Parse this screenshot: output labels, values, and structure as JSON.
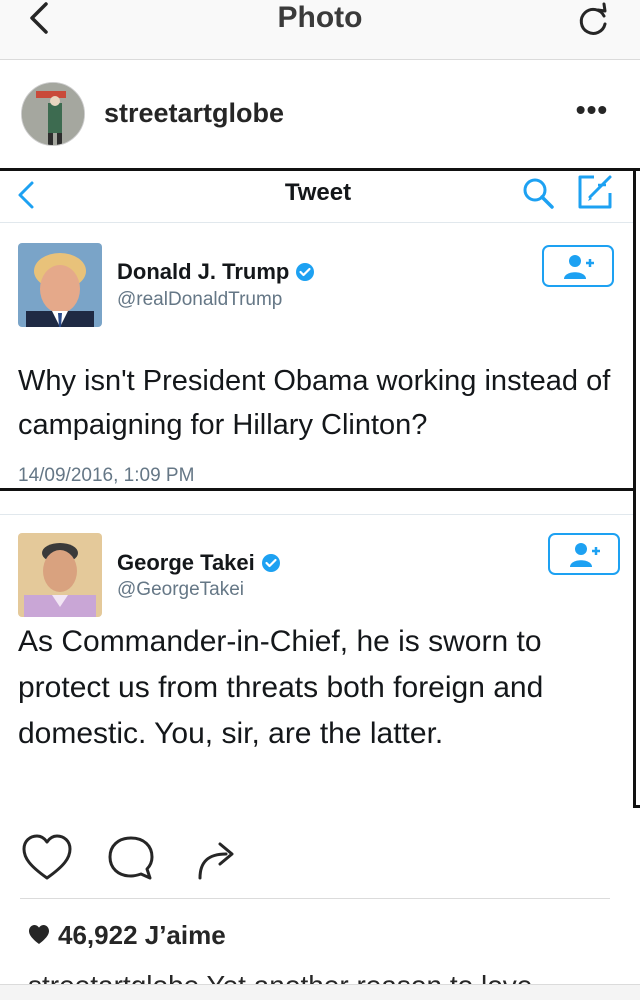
{
  "header": {
    "title": "Photo",
    "back_icon": "chevron-left-icon",
    "refresh_icon": "refresh-icon"
  },
  "post": {
    "author": "streetartglobe",
    "more_icon": "more-dots-icon",
    "more_label": "•••"
  },
  "tweet_view": {
    "title": "Tweet",
    "back_icon": "chevron-left-icon",
    "search_icon": "search-icon",
    "compose_icon": "compose-icon",
    "accent": "#1da1f2"
  },
  "tweets": [
    {
      "name": "Donald J. Trump",
      "handle": "@realDonaldTrump",
      "text": "Why isn't President Obama working instead of campaigning for Hillary Clinton?",
      "timestamp": "14/09/2016, 1:09 PM",
      "verified": true
    },
    {
      "name": "George Takei",
      "handle": "@GeorgeTakei",
      "text": "As Commander-in-Chief, he is sworn to protect us from threats both foreign and domestic. You, sir, are the latter.",
      "verified": true
    }
  ],
  "actions": {
    "like_icon": "heart-icon",
    "comment_icon": "comment-icon",
    "share_icon": "share-icon"
  },
  "likes": {
    "text": "46,922 J’aime"
  },
  "caption": {
    "text": "streetartglobe Yet another reason to love"
  }
}
